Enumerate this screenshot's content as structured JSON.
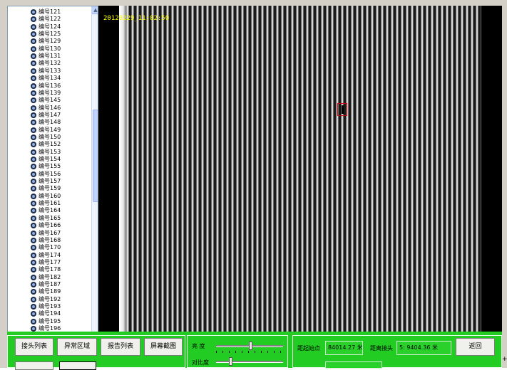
{
  "tree": {
    "items": [
      "编号121",
      "编号122",
      "编号124",
      "编号125",
      "编号129",
      "编号130",
      "编号131",
      "编号132",
      "编号133",
      "编号134",
      "编号136",
      "编号139",
      "编号145",
      "编号146",
      "编号147",
      "编号148",
      "编号149",
      "编号150",
      "编号152",
      "编号153",
      "编号154",
      "编号155",
      "编号156",
      "编号157",
      "编号159",
      "编号160",
      "编号161",
      "编号164",
      "编号165",
      "编号166",
      "编号167",
      "编号168",
      "编号170",
      "编号174",
      "编号177",
      "编号178",
      "编号182",
      "编号187",
      "编号189",
      "编号192",
      "编号193",
      "编号194",
      "编号195",
      "编号196"
    ],
    "scroll_up_glyph": "▲"
  },
  "video": {
    "timestamp": "20120229_11:02:50",
    "marker_color": "#d00000"
  },
  "toolbar": {
    "joint_list": "接头列表",
    "abnormal_area": "异常区域",
    "report_list": "报告列表",
    "screenshot": "屏幕截图",
    "back": "返回"
  },
  "adjust": {
    "brightness_label": "亮  度",
    "contrast_label": "对比度",
    "brightness_level": 0.52,
    "contrast_level": 0.2
  },
  "position": {
    "from_start_label": "距起始点",
    "from_start_value": "84014.27 米",
    "from_joint_label": "距离接头",
    "from_joint_value": "5: 9404.36 米"
  },
  "colors": {
    "panel_bg": "#22cc22",
    "timestamp": "#ffff00"
  }
}
